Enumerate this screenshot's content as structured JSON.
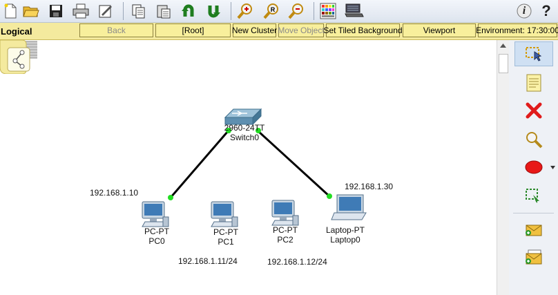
{
  "toolbar": {
    "icons": [
      "new-file-icon",
      "open-folder-icon",
      "save-icon",
      "print-icon",
      "activity-wizard-icon",
      "copy-icon",
      "paste-icon",
      "undo-icon",
      "redo-icon",
      "zoom-in-icon",
      "zoom-reset-icon",
      "zoom-out-icon",
      "custom-palette-icon",
      "custom-device-dialog-icon",
      "info-icon",
      "help-icon"
    ],
    "info_glyph": "i",
    "help_glyph": "?"
  },
  "logical_bar": {
    "mode_label": "Logical",
    "back_label": "Back",
    "root_label": "[Root]",
    "new_cluster_label": "New Cluster",
    "move_object_label": "Move Object",
    "set_tiled_background_label": "Set Tiled Background",
    "viewport_label": "Viewport",
    "environment_label": "Environment: 17:30:00"
  },
  "devices": {
    "switch": {
      "model": "2960-24TT",
      "name": "Switch0"
    },
    "pc0": {
      "model": "PC-PT",
      "name": "PC0"
    },
    "pc1": {
      "model": "PC-PT",
      "name": "PC1"
    },
    "pc2": {
      "model": "PC-PT",
      "name": "PC2"
    },
    "laptop0": {
      "model": "Laptop-PT",
      "name": "Laptop0"
    }
  },
  "ip_notes": {
    "pc0": "192.168.1.10",
    "laptop0": "192.168.1.30",
    "pc1": "192.168.1.11/24",
    "pc2": "192.168.1.12/24"
  },
  "links": [
    {
      "from": "switch",
      "to": "pc0",
      "status_color": "#22dd22"
    },
    {
      "from": "switch",
      "to": "laptop0",
      "status_color": "#22dd22"
    }
  ],
  "right_panel": {
    "tools": [
      "select-tool-icon",
      "place-note-icon",
      "delete-icon",
      "inspect-icon",
      "draw-ellipse-icon",
      "resize-shape-icon",
      "add-simple-pdu-icon",
      "add-complex-pdu-icon"
    ],
    "ellipse_color": "#e81818"
  }
}
